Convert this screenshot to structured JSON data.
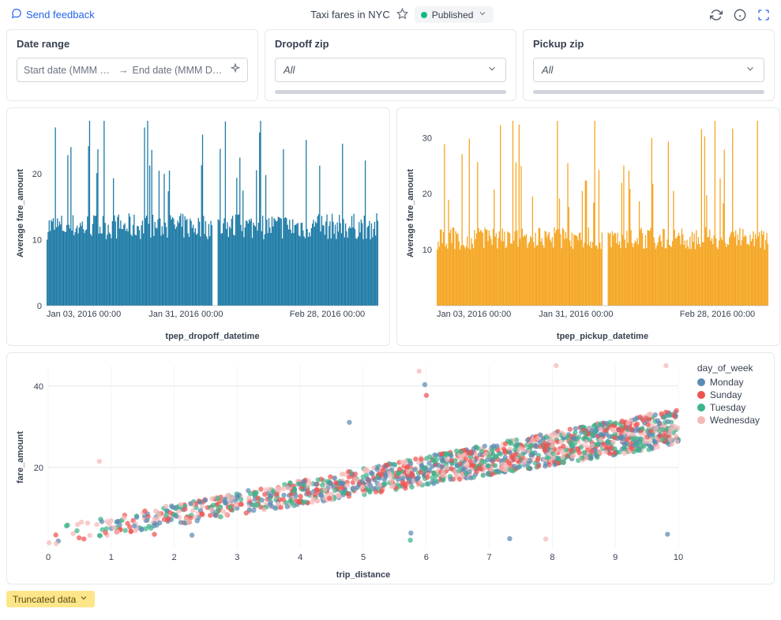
{
  "header": {
    "feedback": "Send feedback",
    "title": "Taxi fares in NYC",
    "status": "Published"
  },
  "filters": {
    "date": {
      "title": "Date range",
      "start_ph": "Start date (MMM DD,…",
      "end_ph": "End date (MMM DD, …"
    },
    "dropoff": {
      "title": "Dropoff zip",
      "value": "All"
    },
    "pickup": {
      "title": "Pickup zip",
      "value": "All"
    }
  },
  "chart_data": [
    {
      "name": "left_bar",
      "type": "bar",
      "xlabel": "tpep_dropoff_datetime",
      "ylabel": "Average fare_amount",
      "color": "#1e7ba6",
      "ylim": [
        0,
        28
      ],
      "yticks": [
        0,
        10,
        20
      ],
      "xticks": [
        "Jan 03, 2016 00:00",
        "Jan 31, 2016 00:00",
        "Feb 28, 2016 00:00"
      ],
      "note": "Hourly avg fare: baseline ≈10–14 with frequent spikes to 18–27; dense vertical bars across the date range with a small gap near end of Jan."
    },
    {
      "name": "right_bar",
      "type": "bar",
      "xlabel": "tpep_pickup_datetime",
      "ylabel": "Average fare_amount",
      "color": "#f5a623",
      "ylim": [
        0,
        33
      ],
      "yticks": [
        10,
        20,
        30
      ],
      "xticks": [
        "Jan 03, 2016 00:00",
        "Jan 31, 2016 00:00",
        "Feb 28, 2016 00:00"
      ],
      "note": "Hourly avg fare: baseline ≈10–14 with spikes to 20–33; similar shape to left chart, small gap near end of Jan."
    },
    {
      "name": "scatter",
      "type": "scatter",
      "xlabel": "trip_distance",
      "ylabel": "fare_amount",
      "xlim": [
        0,
        10
      ],
      "ylim": [
        0,
        45
      ],
      "xticks": [
        0,
        1,
        2,
        3,
        4,
        5,
        6,
        7,
        8,
        9,
        10
      ],
      "yticks": [
        20,
        40
      ],
      "legend_title": "day_of_week",
      "series": [
        {
          "name": "Monday",
          "color": "#5b8bb3"
        },
        {
          "name": "Sunday",
          "color": "#ef5350"
        },
        {
          "name": "Tuesday",
          "color": "#3eb489"
        },
        {
          "name": "Wednesday",
          "color": "#f5b9b9"
        }
      ],
      "note": "Dense point cloud rising roughly linearly from (0,~3) to (10,~30) with outliers up to ~45 and a few low-fare outliers near y≈2."
    }
  ],
  "truncated": "Truncated data"
}
